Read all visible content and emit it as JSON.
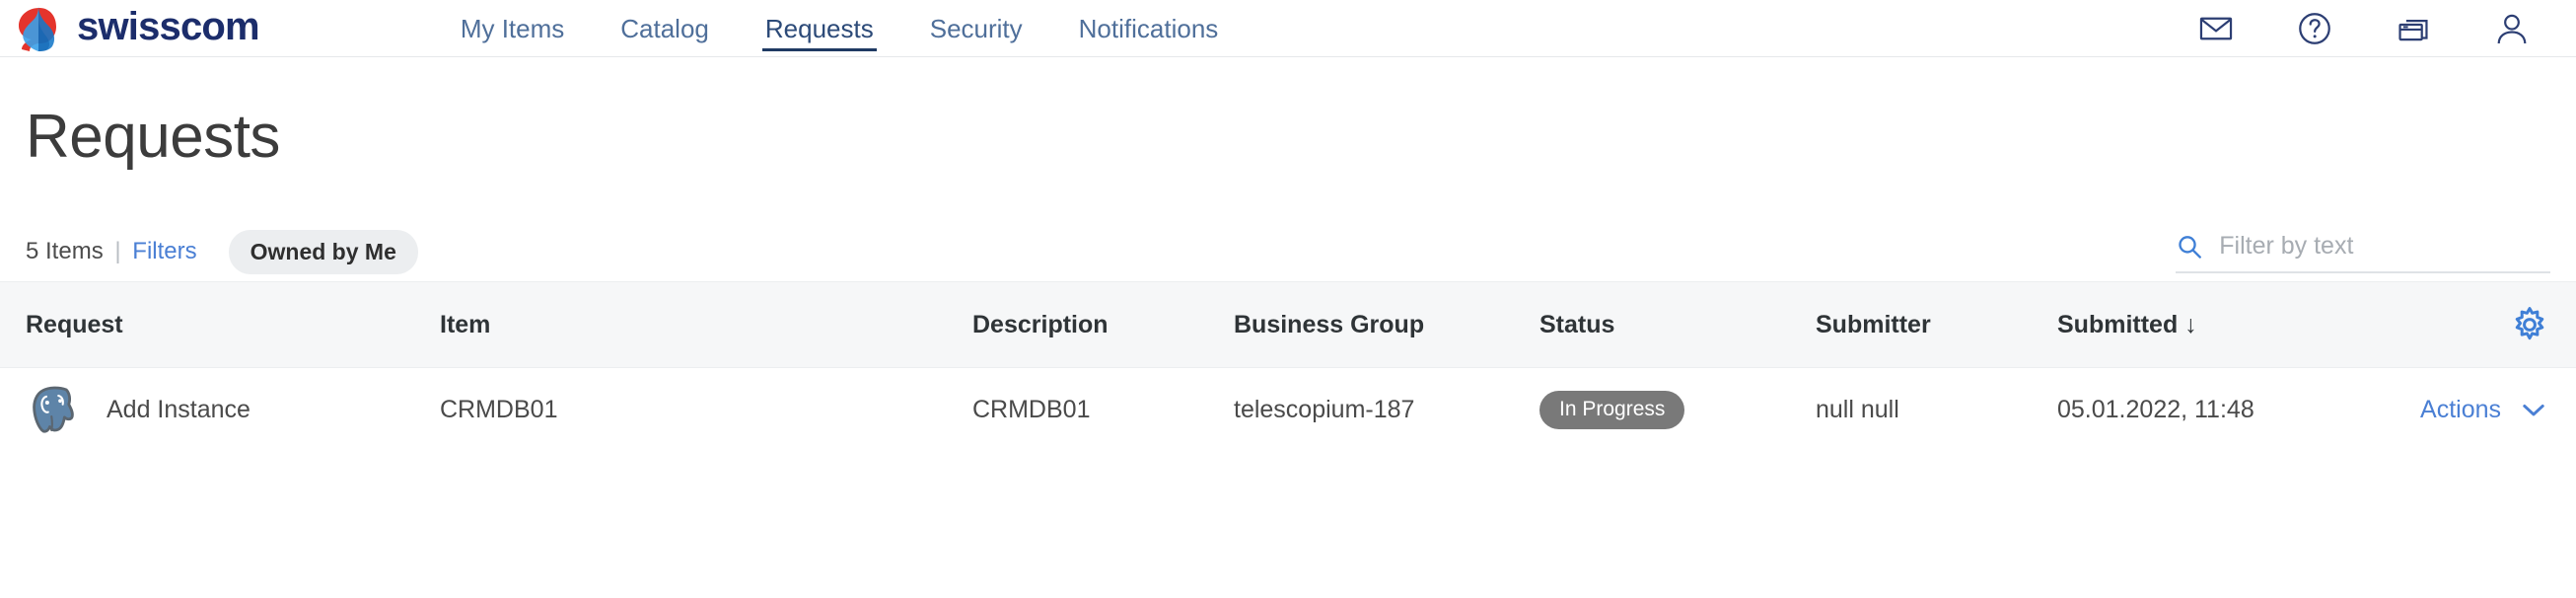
{
  "header": {
    "brand_name": "swisscom",
    "brand_logo_icon": "swisscom-logo",
    "nav": [
      {
        "label": "My Items",
        "active": false
      },
      {
        "label": "Catalog",
        "active": false
      },
      {
        "label": "Requests",
        "active": true
      },
      {
        "label": "Security",
        "active": false
      },
      {
        "label": "Notifications",
        "active": false
      }
    ],
    "icons": [
      {
        "name": "mail-icon"
      },
      {
        "name": "help-circle-icon"
      },
      {
        "name": "windows-icon"
      },
      {
        "name": "user-account-icon"
      }
    ]
  },
  "page": {
    "title": "Requests"
  },
  "toolbar": {
    "item_count": "5 Items",
    "separator": "|",
    "filters_label": "Filters",
    "chip_label": "Owned by Me",
    "search_placeholder": "Filter by text",
    "search_value": "",
    "search_icon": "search-icon"
  },
  "table": {
    "columns": [
      {
        "label": "Request"
      },
      {
        "label": "Item"
      },
      {
        "label": "Description"
      },
      {
        "label": "Business Group"
      },
      {
        "label": "Status"
      },
      {
        "label": "Submitter"
      },
      {
        "label": "Submitted"
      }
    ],
    "sort_column": "Submitted",
    "sort_arrow": "↓",
    "settings_icon": "gear-icon",
    "rows": [
      {
        "icon": "postgresql-icon",
        "request": "Add Instance",
        "item": "CRMDB01",
        "description": "CRMDB01",
        "business_group": "telescopium-187",
        "status": "In Progress",
        "submitter": "null null",
        "submitted": "05.01.2022, 11:48",
        "actions_label": "Actions",
        "actions_icon": "chevron-down-icon"
      }
    ]
  },
  "colors": {
    "brand_navy": "#1c2d6b",
    "link_blue": "#4a7fd4",
    "nav_blue": "#4f6f9a",
    "status_gray": "#797979",
    "header_row_bg": "#f6f7f8"
  }
}
